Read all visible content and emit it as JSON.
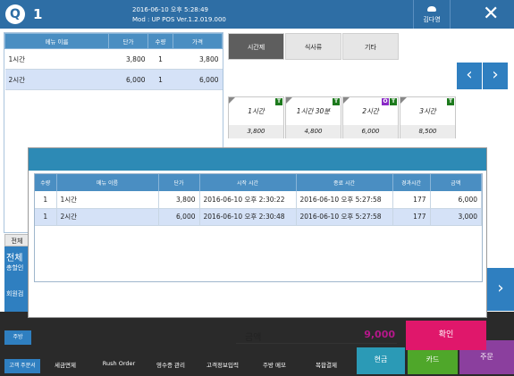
{
  "header": {
    "logo_glyph": "Q",
    "table_number": "1",
    "datetime": "2016-06-10 오후 5:28:49",
    "mod_info": "Mod : UP POS Ver.1.2.019.000",
    "user_name": "김다영",
    "close_glyph": "✕"
  },
  "order_table": {
    "columns": [
      "메뉴 이름",
      "단가",
      "수량",
      "가격"
    ],
    "rows": [
      {
        "name": "1시간",
        "unit_price": "3,800",
        "qty": "1",
        "price": "3,800"
      },
      {
        "name": "2시간",
        "unit_price": "6,000",
        "qty": "1",
        "price": "6,000"
      }
    ]
  },
  "left_panel": {
    "total_tab": "전체",
    "total_label": "전체",
    "total_sub": "총할인",
    "member_label": "회원검"
  },
  "tabs": [
    {
      "label": "시간제",
      "active": true
    },
    {
      "label": "식사류",
      "active": false
    },
    {
      "label": "기타",
      "active": false
    }
  ],
  "nav": {
    "prev": "‹",
    "next": "›"
  },
  "menu_cards": [
    {
      "name": "1시간",
      "price": "3,800",
      "badges": [
        "T"
      ]
    },
    {
      "name": "1시간 30분",
      "price": "4,800",
      "badges": [
        "T"
      ]
    },
    {
      "name": "2시간",
      "price": "6,000",
      "badges": [
        "O",
        "T"
      ]
    },
    {
      "name": "3시간",
      "price": "8,500",
      "badges": [
        "T"
      ]
    }
  ],
  "modal": {
    "columns": [
      "수량",
      "메뉴 이름",
      "단가",
      "시작 시간",
      "종료 시간",
      "경과시간",
      "금액"
    ],
    "rows": [
      {
        "qty": "1",
        "name": "1시간",
        "unit_price": "3,800",
        "start": "2016-06-10 오후 2:30:22",
        "end": "2016-06-10 오후 5:27:58",
        "elapsed": "177",
        "amount": "6,000"
      },
      {
        "qty": "1",
        "name": "2시간",
        "unit_price": "6,000",
        "start": "2016-06-10 오후 2:30:48",
        "end": "2016-06-10 오후 5:27:58",
        "elapsed": "177",
        "amount": "3,000"
      }
    ],
    "amount_label": "금액",
    "amount_value": "9,000",
    "confirm_label": "확인"
  },
  "bottom": {
    "side_top": "주방",
    "side_bottom": "고객 주문서",
    "tools": [
      "세금면제",
      "Rush Order",
      "영수증 관리",
      "고객정보입력",
      "주방 메모",
      "복합결제"
    ],
    "pay_cash": "현금",
    "pay_card": "카드",
    "order": "주문"
  },
  "colors": {
    "primary": "#2e6ea5",
    "accent": "#e0176b",
    "amount": "#b5178a"
  }
}
